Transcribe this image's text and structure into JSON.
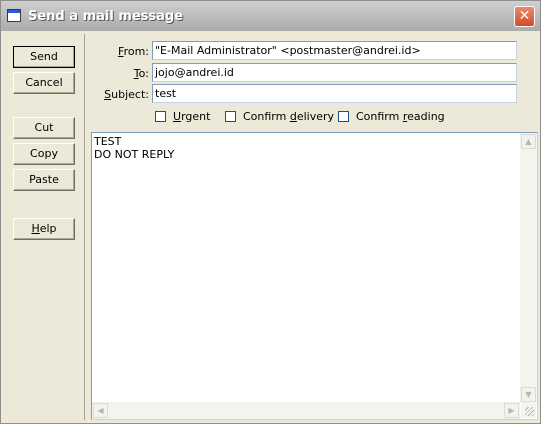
{
  "window": {
    "title": "Send a mail message",
    "close_symbol": "✕"
  },
  "buttons": {
    "send": "Send",
    "cancel": "Cancel",
    "cut": "Cut",
    "copy": "Copy",
    "paste": "Paste",
    "help_prefix": "",
    "help_u": "H",
    "help_rest": "elp"
  },
  "fields": {
    "from": {
      "label_u": "F",
      "label_rest": "rom:",
      "value": "\"E-Mail Administrator\" <postmaster@andrei.id>"
    },
    "to": {
      "label_u": "T",
      "label_rest": "o:",
      "value": "jojo@andrei.id"
    },
    "subject": {
      "label_u": "S",
      "label_rest": "ubject:",
      "value": "test"
    }
  },
  "options": {
    "urgent": {
      "u": "U",
      "rest": "rgent",
      "checked": false
    },
    "confirm_delivery": {
      "pre": "Confirm ",
      "u": "d",
      "rest": "elivery",
      "checked": false
    },
    "confirm_reading": {
      "pre": "Confirm ",
      "u": "r",
      "rest": "eading",
      "checked": false
    }
  },
  "message": {
    "line1": "TEST",
    "line2": "DO NOT REPLY"
  }
}
